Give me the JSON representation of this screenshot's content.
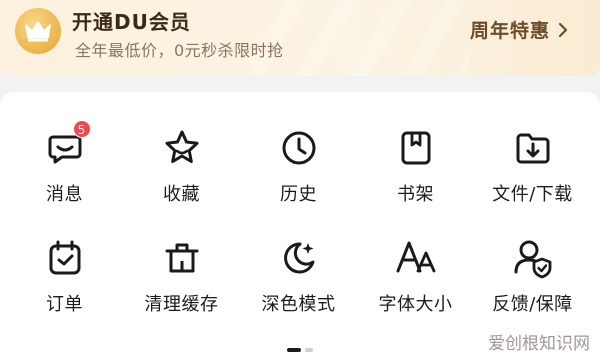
{
  "vip": {
    "title": "开通DU会员",
    "subtitle": "全年最低价，0元秒杀限时抢",
    "promo_label": "周年特惠"
  },
  "menu": {
    "items": [
      {
        "label": "消息",
        "icon": "message-icon",
        "badge": "5"
      },
      {
        "label": "收藏",
        "icon": "star-icon"
      },
      {
        "label": "历史",
        "icon": "clock-icon"
      },
      {
        "label": "书架",
        "icon": "bookshelf-icon"
      },
      {
        "label": "文件/下载",
        "icon": "download-folder-icon"
      },
      {
        "label": "订单",
        "icon": "calendar-check-icon"
      },
      {
        "label": "清理缓存",
        "icon": "trash-icon"
      },
      {
        "label": "深色模式",
        "icon": "moon-icon"
      },
      {
        "label": "字体大小",
        "icon": "font-size-icon"
      },
      {
        "label": "反馈/保障",
        "icon": "user-shield-icon"
      }
    ]
  },
  "pager": {
    "active_index": 0,
    "count": 2
  },
  "watermark": "爱创根知识网",
  "colors": {
    "badge": "#f2464e",
    "gold": "#eeb950",
    "promo_text": "#6e4d26"
  }
}
